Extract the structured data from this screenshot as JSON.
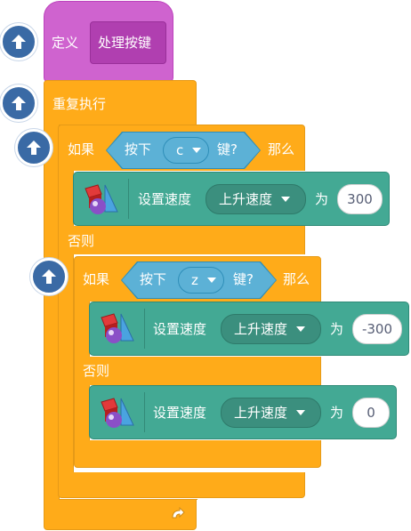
{
  "define": {
    "keyword": "定义",
    "block_name": "处理按键"
  },
  "forever": {
    "label": "重复执行"
  },
  "if_outer": {
    "if_label": "如果",
    "condition_prefix": "按下",
    "key": "c",
    "condition_suffix": "键?",
    "then_label": "那么",
    "action": {
      "set_label": "设置速度",
      "property": "上升速度",
      "to_label": "为",
      "value": "300"
    },
    "else_label": "否则"
  },
  "if_inner": {
    "if_label": "如果",
    "condition_prefix": "按下",
    "key": "z",
    "condition_suffix": "键?",
    "then_label": "那么",
    "action_then": {
      "set_label": "设置速度",
      "property": "上升速度",
      "to_label": "为",
      "value": "-300"
    },
    "else_label": "否则",
    "action_else": {
      "set_label": "设置速度",
      "property": "上升速度",
      "to_label": "为",
      "value": "0"
    }
  },
  "colors": {
    "define": "#cf63cf",
    "control": "#ffab19",
    "motion": "#43a994",
    "sensing": "#5cb1d6",
    "jump_button": "#3a6aa5"
  },
  "icons": {
    "jump_button": "up-arrow-icon",
    "motion_extension": "physics-shapes-icon",
    "loop_end": "loop-arrow-icon"
  }
}
